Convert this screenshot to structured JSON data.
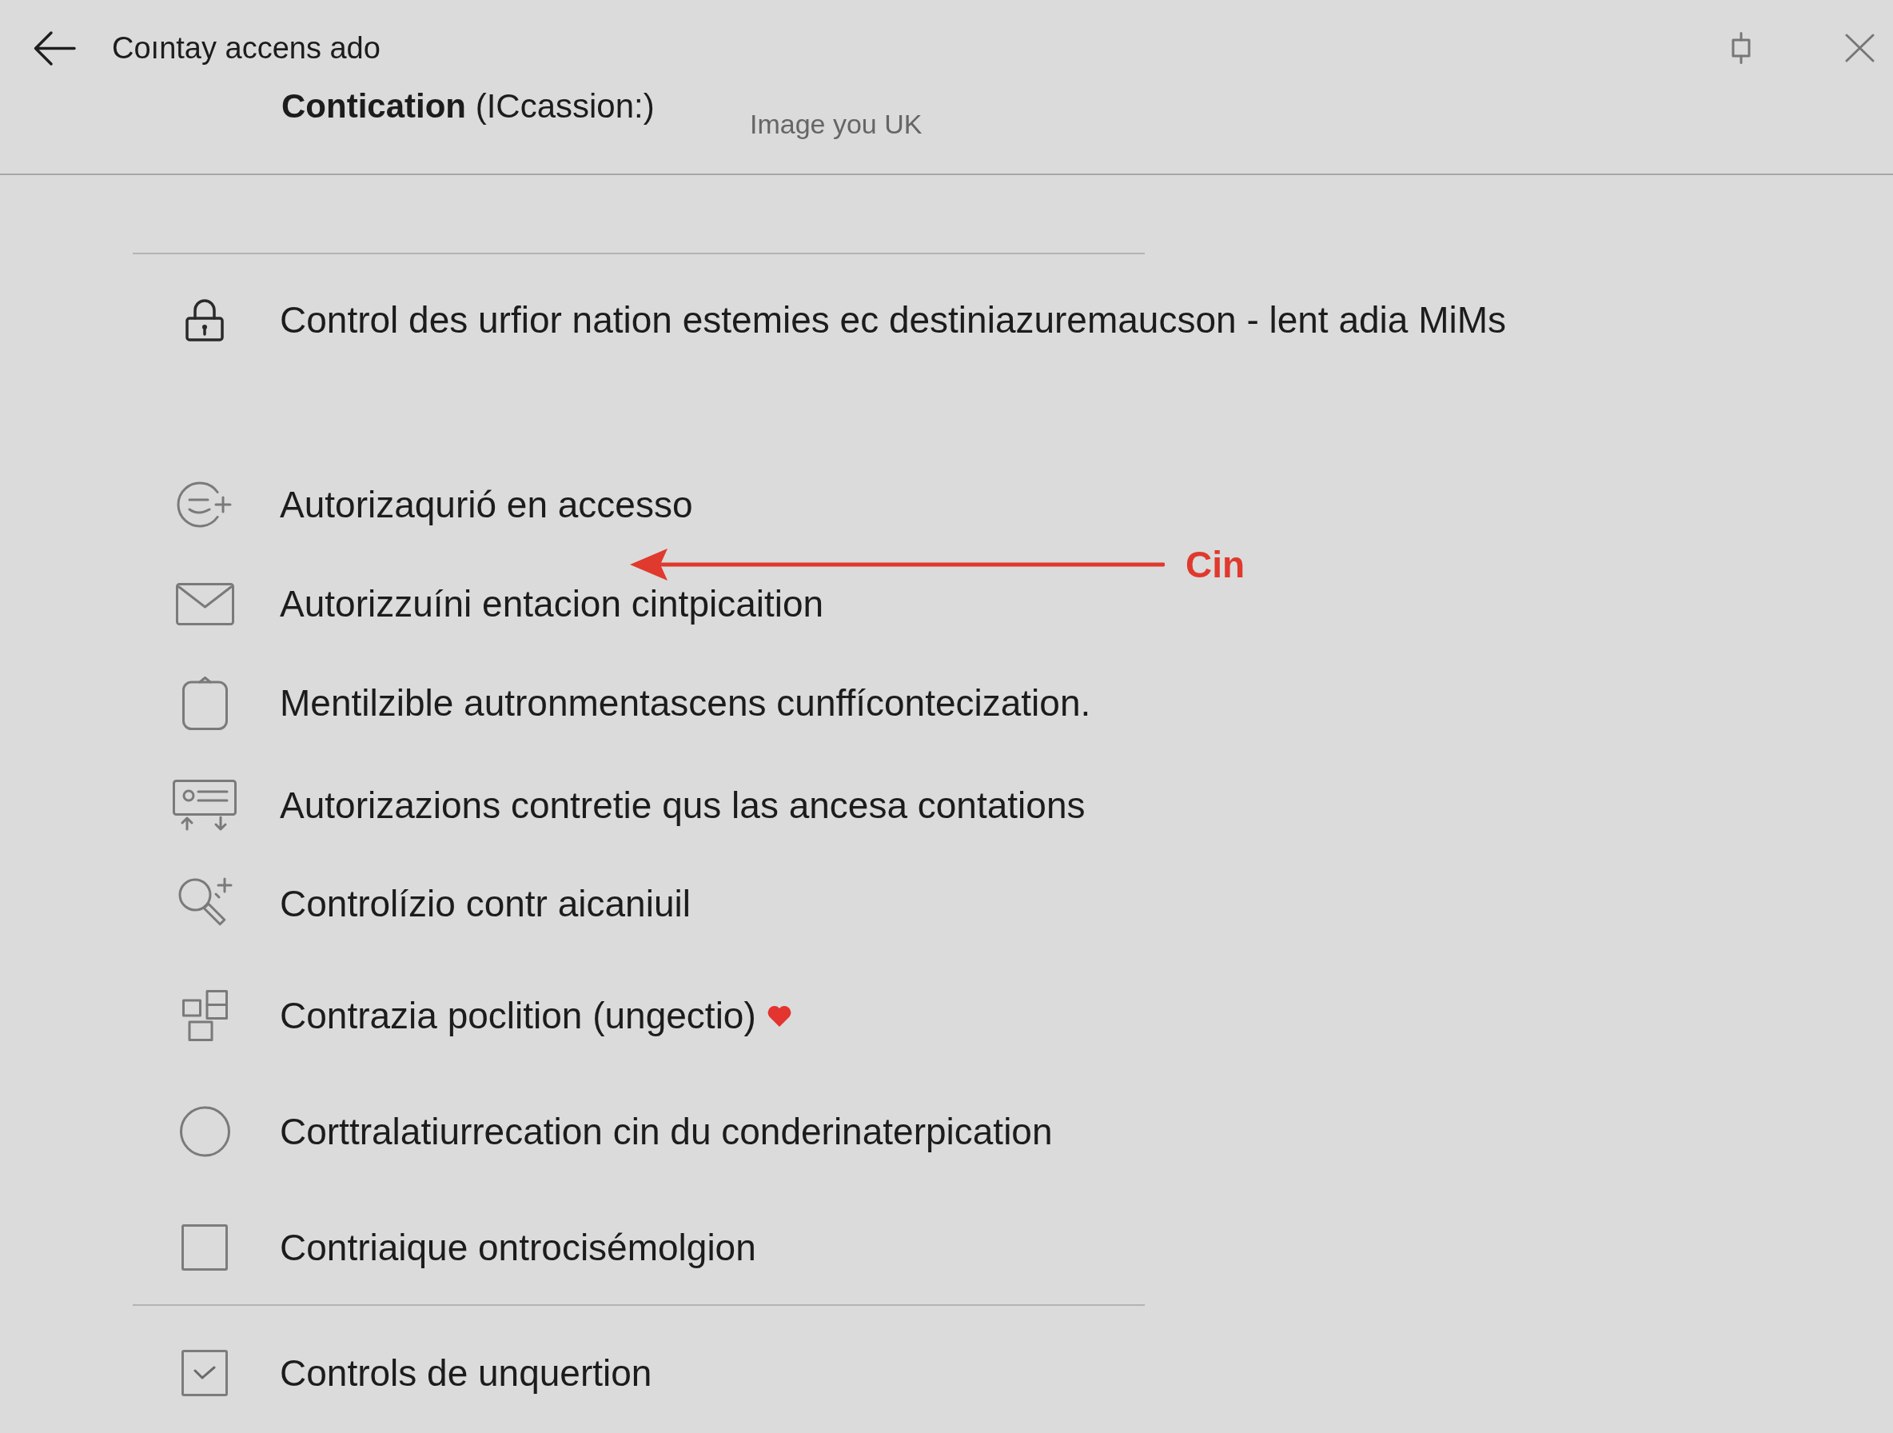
{
  "header": {
    "title": "Coıntay accens ado",
    "subtitle": "**Contication** (ICcassion:)",
    "caption": "Image you UK"
  },
  "items": [
    {
      "kind": "icon",
      "label": "Control des urfior nation estemies ec destiniazuremaucson - lent adia MiMs",
      "favorite": false
    },
    {
      "kind": "icon",
      "label": "Autorizaqurió en accesso",
      "favorite": false
    },
    {
      "kind": "icon",
      "label": "Autorizzuíni entacion cintpicaition",
      "favorite": false
    },
    {
      "kind": "icon",
      "label": "Mentilzible autronmentascens cunffícontecization.",
      "favorite": false
    },
    {
      "kind": "icon",
      "label": "Autorizazions contretie qus las ancesa contations",
      "favorite": false
    },
    {
      "kind": "icon",
      "label": "Controlízio contr aicaniuil",
      "favorite": false
    },
    {
      "kind": "icon",
      "label": "Contrazia poclition (ungectio)",
      "favorite": true
    },
    {
      "kind": "icon",
      "label": "Corttralatiurrecation cin du conderinaterpication",
      "favorite": false
    },
    {
      "kind": "checkbox",
      "label": "Contriaique ontrocisémolgion",
      "checked": false,
      "favorite": false
    },
    {
      "kind": "checkbox",
      "label": "Controls de unquertion",
      "checked": true,
      "favorite": false
    }
  ],
  "annotation": {
    "label": "Cin"
  }
}
